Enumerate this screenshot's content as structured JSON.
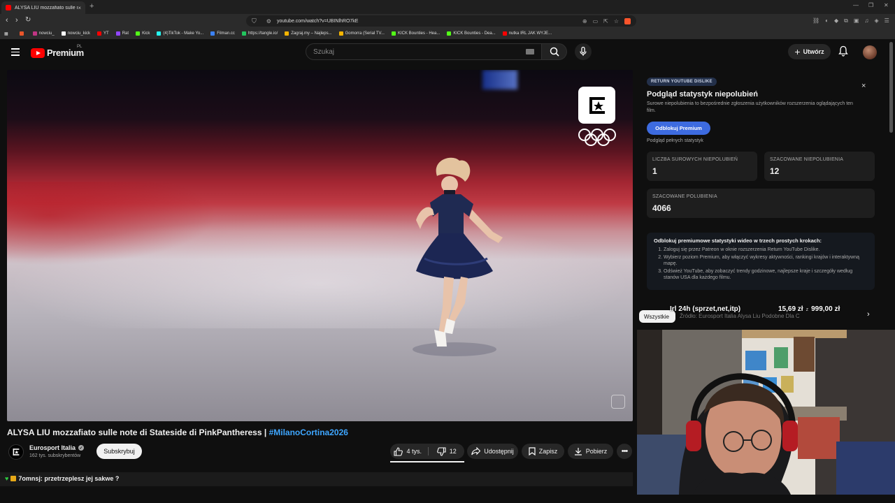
{
  "browser": {
    "tab_title": "ALYSA LIU mozzafiato sulle note",
    "tab_close": "×",
    "new_tab": "+",
    "url": "youtube.com/watch?v=UBINlhRO7kE",
    "bookmarks": [
      {
        "label": "",
        "color": "#e9552a"
      },
      {
        "label": "nowciu_",
        "color": "#c13584"
      },
      {
        "label": "nowciu_kick",
        "color": "#ffffff"
      },
      {
        "label": "YT",
        "color": "#ff0000"
      },
      {
        "label": "Rat",
        "color": "#9146ff"
      },
      {
        "label": "Kick",
        "color": "#53fc18"
      },
      {
        "label": "(4)TikTok - Make Yo...",
        "color": "#25f4ee"
      },
      {
        "label": "Filman.cc",
        "color": "#3b82f6"
      },
      {
        "label": "https://tangle.io/",
        "color": "#22c55e"
      },
      {
        "label": "Zagraj.my – Najleps...",
        "color": "#f5b400"
      },
      {
        "label": "Gomorra (Serial TV...",
        "color": "#f5b400"
      },
      {
        "label": "KICK Bounties - Hea...",
        "color": "#53fc18"
      },
      {
        "label": "KICK Bounties - Dea...",
        "color": "#53fc18"
      },
      {
        "label": "nutka IRL JAK WYJE...",
        "color": "#ff0000"
      }
    ]
  },
  "header": {
    "logo_text": "Premium",
    "country": "PL",
    "search_placeholder": "Szukaj",
    "create_label": "Utwórz"
  },
  "video": {
    "title": "ALYSA LIU mozzafiato sulle note di Stateside di PinkPantheress | ",
    "hashtag": "#MilanoCortina2026",
    "channel": "Eurosport Italia",
    "subscribers": "162 tys. subskrybentów",
    "subscribe_label": "Subskrybuj",
    "likes": "4 tys.",
    "dislikes": "12",
    "share_label": "Udostępnij",
    "save_label": "Zapisz",
    "download_label": "Pobierz"
  },
  "chat_message": "7omnsj: przetrzeplesz jej sakwe ?",
  "ryd": {
    "badge": "RETURN YOUTUBE DISLIKE",
    "title": "Podgląd statystyk niepolubień",
    "description": "Surowe niepolubienia to bezpośrednie zgłoszenia użytkowników rozszerzenia oglądających ten film.",
    "unlock_label": "Odblokuj Premium",
    "full_stats": "Podgląd pełnych statystyk",
    "raw_dislikes_label": "LICZBA SUROWYCH NIEPOLUBIEŃ",
    "raw_dislikes_value": "1",
    "est_dislikes_label": "SZACOWANE NIEPOLUBIENIA",
    "est_dislikes_value": "12",
    "est_likes_label": "SZACOWANE POLUBIENIA",
    "est_likes_value": "4066",
    "steps_head": "Odblokuj premiumowe statystyki wideo w trzech prostych krokach:",
    "steps": [
      "Zaloguj się przez Patreon w oknie rozszerzenia Return YouTube Dislike.",
      "Wybierz poziom Premium, aby włączyć wykresy aktywności, rankingi krajów i interaktywną mapę.",
      "Odśwież YouTube, aby zobaczyć trendy godzinowe, najlepsze kraje i szczegóły według stanów USA dla każdego filmu."
    ]
  },
  "chips": {
    "all": "Wszystkie",
    "ghost": "Źródło: Eurosport Italia   Alysa Liu   Podobne   Dla C"
  },
  "overlay": {
    "left": "Irl 24h (sprzet,net,itp)",
    "amount": "15,69 zł",
    "of": "z",
    "goal": "999,00 zł"
  }
}
